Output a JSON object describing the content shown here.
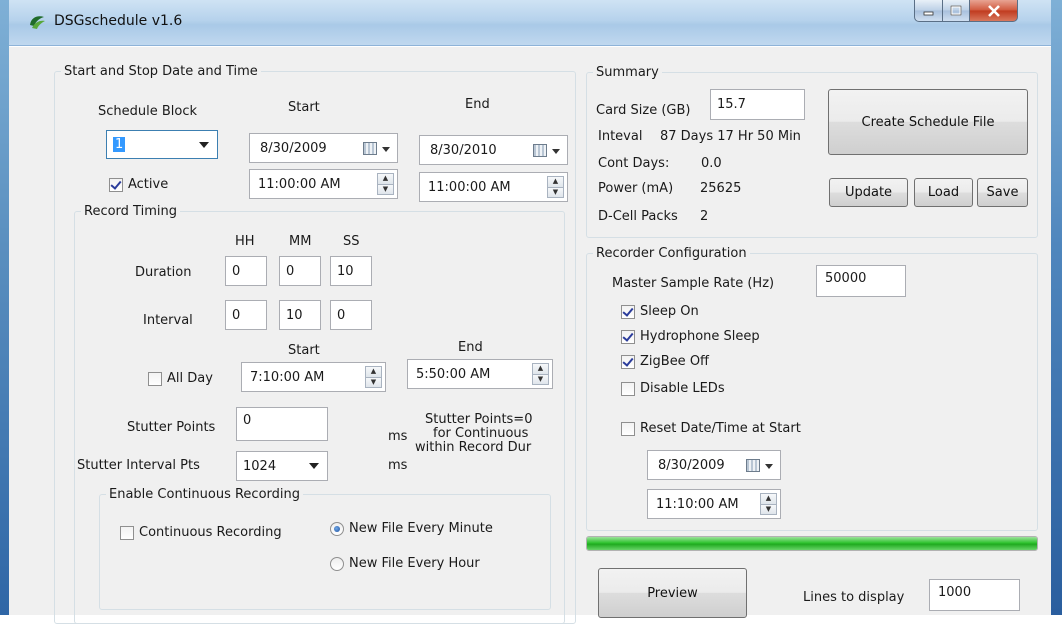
{
  "window": {
    "title": "DSGschedule v1.6"
  },
  "dates": {
    "group_label": "Start and Stop Date and Time",
    "schedule_block_label": "Schedule Block",
    "schedule_block_value": "1",
    "start_heading": "Start",
    "end_heading": "End",
    "start_date": "8/30/2009",
    "end_date": "8/30/2010",
    "start_time": "11:00:00 AM",
    "end_time": "11:00:00 AM",
    "active_label": "Active",
    "active_checked": true
  },
  "record_timing": {
    "group_label": "Record Timing",
    "hh_label": "HH",
    "mm_label": "MM",
    "ss_label": "SS",
    "duration_label": "Duration",
    "duration": {
      "hh": "0",
      "mm": "0",
      "ss": "10"
    },
    "interval_label": "Interval",
    "interval": {
      "hh": "0",
      "mm": "10",
      "ss": "0"
    },
    "start_heading": "Start",
    "end_heading": "End",
    "all_day_label": "All Day",
    "all_day_checked": false,
    "start_time": "7:10:00 AM",
    "end_time": "5:50:00 AM",
    "stutter_points_label": "Stutter Points",
    "stutter_points_value": "0",
    "stutter_interval_label": "Stutter Interval Pts",
    "stutter_interval_value": "1024",
    "ms_unit": "ms",
    "stutter_note_1": "Stutter Points=0",
    "stutter_note_2": "for Continuous",
    "stutter_note_3": "within Record Dur"
  },
  "continuous": {
    "group_label": "Enable Continuous Recording",
    "continuous_label": "Continuous Recording",
    "continuous_checked": false,
    "new_file_minute": "New File Every Minute",
    "new_file_hour": "New File Every Hour",
    "selected": "minute"
  },
  "summary": {
    "group_label": "Summary",
    "card_size_label": "Card Size (GB)",
    "card_size_value": "15.7",
    "interval_label": "Inteval",
    "interval_value": "87 Days 17 Hr 50 Min",
    "cont_days_label": "Cont Days:",
    "cont_days_value": "0.0",
    "power_label": "Power (mA)",
    "power_value": "25625",
    "dcell_label": "D-Cell Packs",
    "dcell_value": "2",
    "create_button": "Create Schedule File",
    "update_button": "Update",
    "load_button": "Load",
    "save_button": "Save"
  },
  "recorder": {
    "group_label": "Recorder Configuration",
    "sample_rate_label": "Master Sample Rate (Hz)",
    "sample_rate_value": "50000",
    "sleep_on_label": "Sleep On",
    "sleep_on_checked": true,
    "hydrophone_sleep_label": "Hydrophone Sleep",
    "hydrophone_sleep_checked": true,
    "zigbee_off_label": "ZigBee Off",
    "zigbee_off_checked": true,
    "disable_leds_label": "Disable LEDs",
    "disable_leds_checked": false,
    "reset_label": "Reset Date/Time at Start",
    "reset_checked": false,
    "reset_date": "8/30/2009",
    "reset_time": "11:10:00 AM"
  },
  "progress": {
    "fraction": 1.0,
    "color": "#2fc32f"
  },
  "preview": {
    "button": "Preview",
    "lines_label": "Lines to display",
    "lines_value": "1000"
  }
}
